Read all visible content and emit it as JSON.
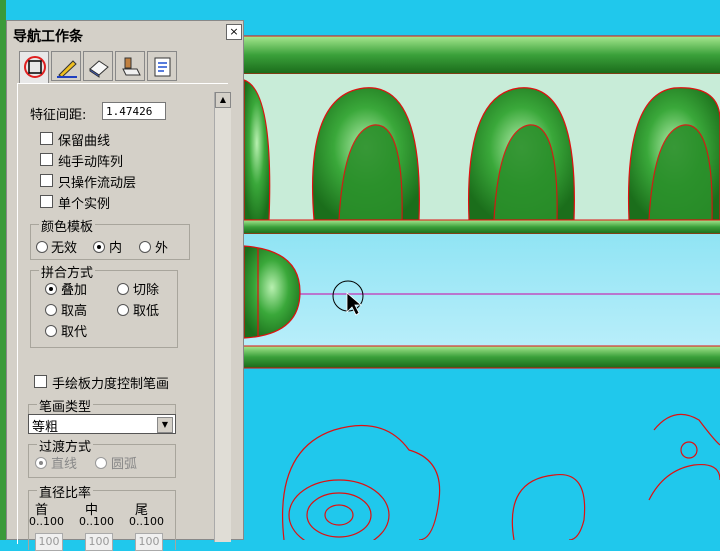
{
  "panel": {
    "title": "导航工作条",
    "close": "×",
    "tabs": [
      "circle-frame-tool",
      "pen-tool",
      "eraser-tool",
      "stamp-tool",
      "document-tool"
    ],
    "feature_spacing_label": "特征间距:",
    "feature_spacing_value": "1.47426",
    "checkboxes": [
      "保留曲线",
      "纯手动阵列",
      "只操作流动层",
      "单个实例"
    ],
    "color_template": {
      "title": "颜色模板",
      "options": [
        "无效",
        "内",
        "外"
      ],
      "selected": "内"
    },
    "merge_mode": {
      "title": "拼合方式",
      "options": [
        "叠加",
        "切除",
        "取高",
        "取低",
        "取代"
      ],
      "selected": "叠加"
    },
    "tablet_pressure_label": "手绘板力度控制笔画",
    "stroke_type": {
      "title": "笔画类型",
      "value": "等粗"
    },
    "transition": {
      "title": "过渡方式",
      "options": [
        "直线",
        "圆弧"
      ],
      "selected": "直线"
    },
    "diameter_ratio": {
      "title": "直径比率",
      "columns": [
        "首",
        "中",
        "尾"
      ],
      "ranges": [
        "0..100",
        "0..100",
        "0..100"
      ],
      "values": [
        "100",
        "100",
        "100"
      ]
    }
  },
  "colors": {
    "canvas_bg": "#20c8ec",
    "panel_bg": "#d4d0c8",
    "relief_green": "#2f9a2f",
    "outline_red": "#e01010"
  }
}
